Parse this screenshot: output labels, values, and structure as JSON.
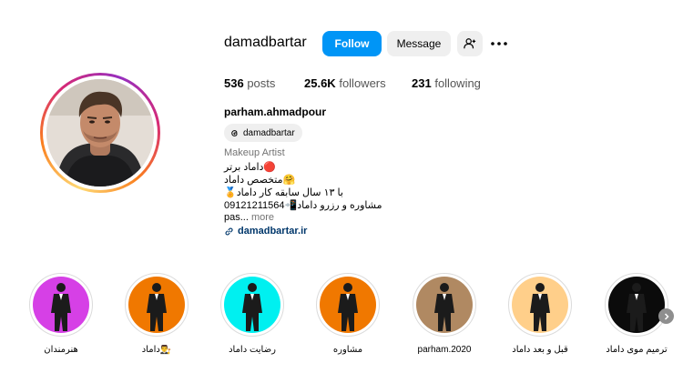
{
  "profile": {
    "username": "damadbartar",
    "follow_label": "Follow",
    "message_label": "Message",
    "posts_count": "536",
    "posts_label": "posts",
    "followers_count": "25.6K",
    "followers_label": "followers",
    "following_count": "231",
    "following_label": "following",
    "full_name": "parham.ahmadpour",
    "threads_handle": "damadbartar",
    "category": "Makeup Artist",
    "bio_lines": [
      "داماد برتر🔴",
      "متخصص داماد🤗",
      "🏅با ۱۳ سال سابقه کار داماد",
      "09121211564📲مشاوره و رزرو داماد"
    ],
    "bio_truncated": "pas...",
    "more_label": "more",
    "website": "damadbartar.ir"
  },
  "highlights": [
    {
      "label": "هنرمندان",
      "bg": "#d640e6"
    },
    {
      "label": "داماد👨‍⚖️",
      "bg": "#f07800"
    },
    {
      "label": "رضایت داماد",
      "bg": "#00f0f0"
    },
    {
      "label": "مشاوره",
      "bg": "#f07800"
    },
    {
      "label": "parham.2020",
      "bg": "#b08962"
    },
    {
      "label": "قبل و بعد داماد",
      "bg": "#ffcf8a"
    },
    {
      "label": "ترمیم موی داماد",
      "bg": "#0b0b0b"
    }
  ],
  "colors": {
    "follow_button": "#0095f6",
    "secondary_button": "#efefef",
    "link": "#00376b"
  }
}
